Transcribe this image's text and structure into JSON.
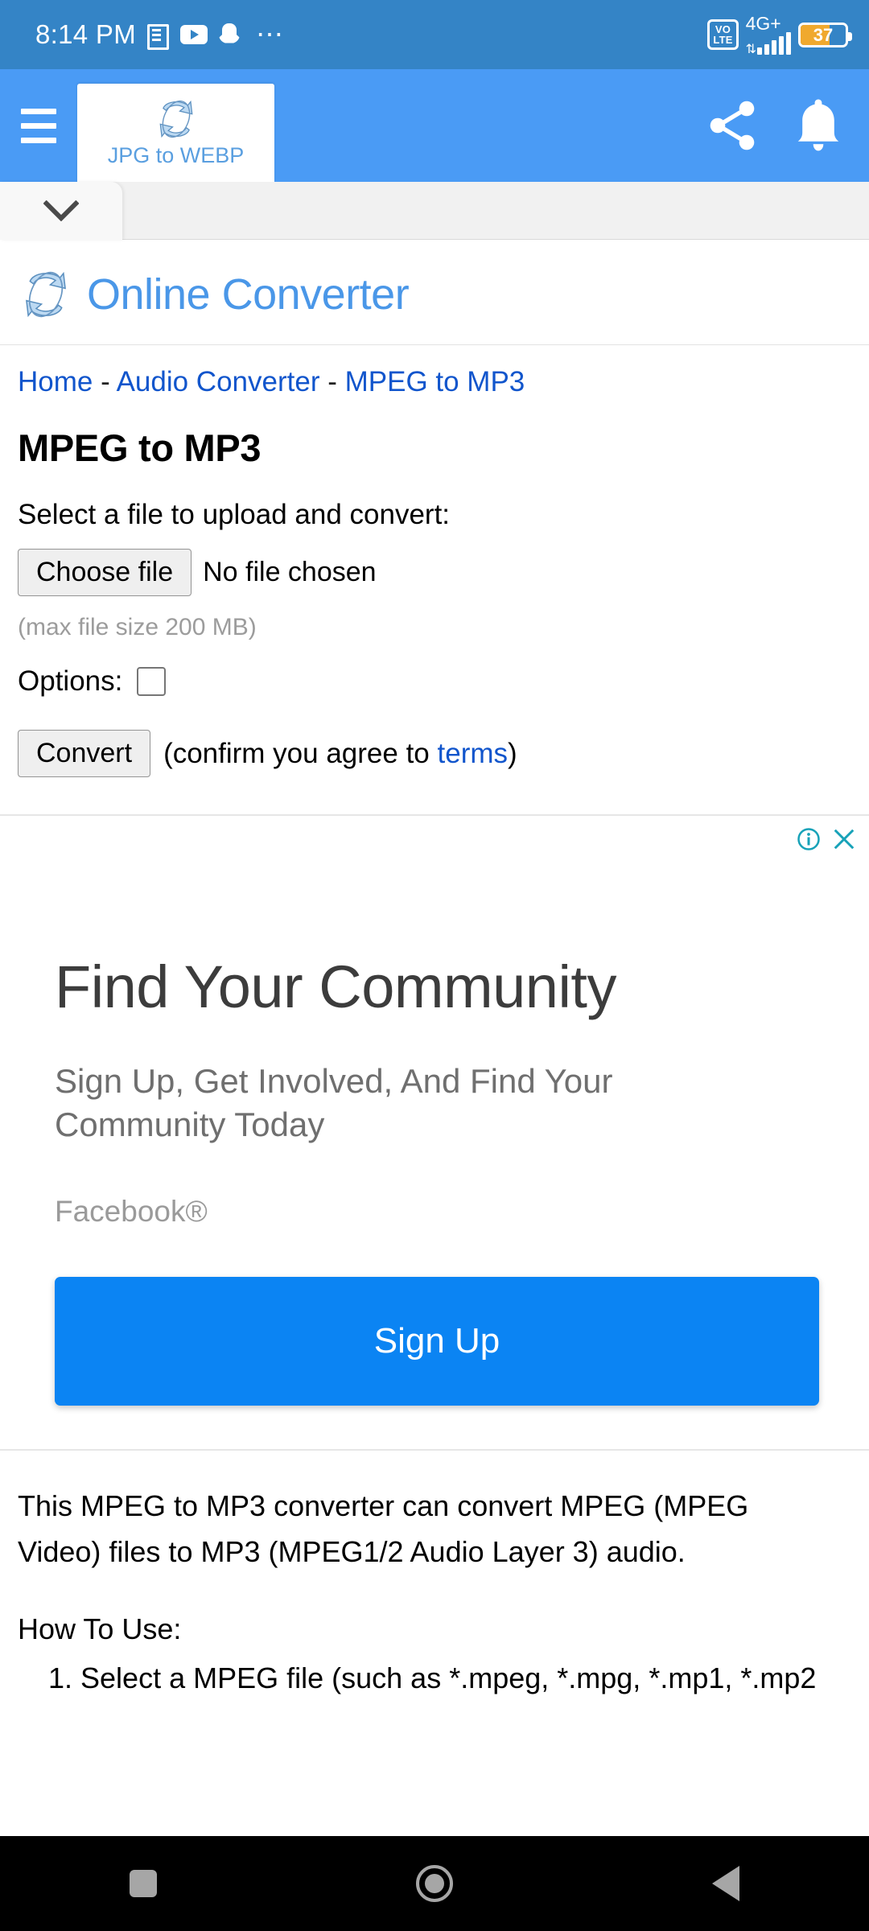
{
  "status_bar": {
    "time": "8:14 PM",
    "notification_icons": [
      "news-icon",
      "youtube-icon",
      "snapchat-icon",
      "more-dots-icon"
    ],
    "volte_line1": "VO",
    "volte_line2": "LTE",
    "network": "4G+",
    "signal_bars": 5,
    "battery_percent": "37",
    "bg_color": "#3484c6"
  },
  "app_bar": {
    "menu_icon": "hamburger-menu-icon",
    "tab_label": "JPG to WEBP",
    "tab_logo": "converter-logo-icon",
    "share_icon": "share-icon",
    "notification_icon": "bell-icon",
    "bg_color": "#4a9bf5"
  },
  "sub_bar": {
    "expand_icon": "chevron-down-icon"
  },
  "site": {
    "brand": "Online Converter",
    "brand_logo": "converter-logo-icon",
    "breadcrumb": {
      "home": "Home",
      "sep1": " - ",
      "category": "Audio Converter",
      "sep2": " - ",
      "current": "MPEG to MP3"
    },
    "page_title": "MPEG to MP3"
  },
  "form": {
    "select_label": "Select a file to upload and convert:",
    "choose_file_button": "Choose file",
    "file_status": "No file chosen",
    "max_size_note": "(max file size 200 MB)",
    "options_label": "Options:",
    "options_checked": false,
    "convert_button": "Convert",
    "confirm_prefix": "(confirm you agree to ",
    "terms_link": "terms",
    "confirm_suffix": ")"
  },
  "ad": {
    "info_icon": "ad-info-icon",
    "close_icon": "ad-close-icon",
    "headline": "Find Your Community",
    "subtext": "Sign Up, Get Involved, And Find Your Community Today",
    "advertiser": "Facebook®",
    "cta_label": "Sign Up",
    "cta_color": "#0b84f3"
  },
  "description": {
    "paragraph1": "This MPEG to MP3 converter can convert MPEG (MPEG Video) files to MP3 (MPEG1/2 Audio Layer 3) audio.",
    "how_to_use_heading": "How To Use:",
    "step1": "1. Select a MPEG file (such as *.mpeg, *.mpg, *.mp1, *.mp2"
  },
  "nav_bar": {
    "recents_icon": "recents-square-icon",
    "home_icon": "home-circle-icon",
    "back_icon": "back-triangle-icon"
  }
}
